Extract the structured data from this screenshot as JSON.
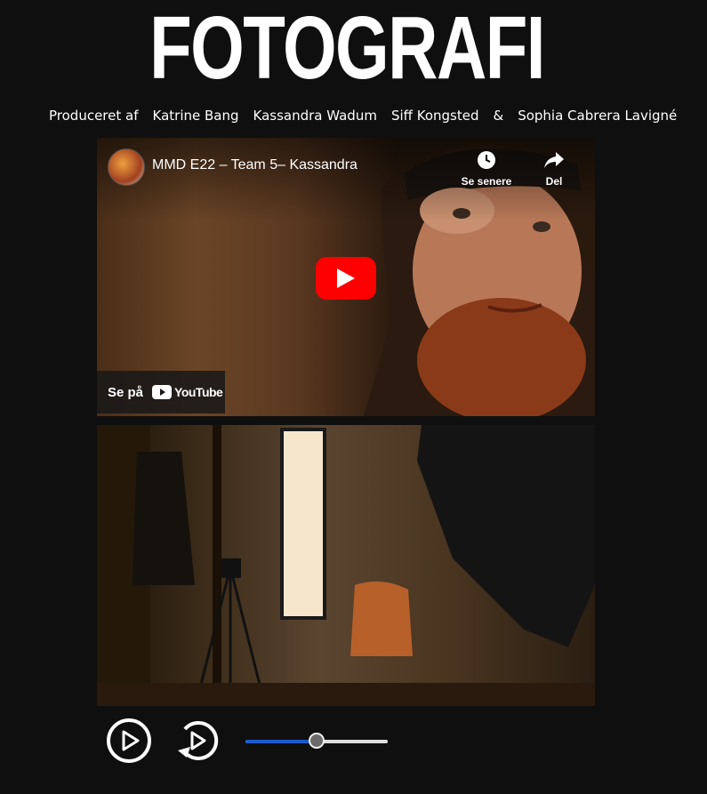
{
  "header": {
    "title": "FOTOGRAFI"
  },
  "credits": {
    "intro": "Produceret af",
    "names": [
      "Katrine Bang",
      "Kassandra Wadum",
      "Siff Kongsted"
    ],
    "ampersand": "&",
    "last": "Sophia Cabrera Lavigné"
  },
  "video": {
    "title": "MMD E22 – Team 5– Kassandra",
    "watch_later_label": "Se senere",
    "share_label": "Del",
    "watch_on_label": "Se på",
    "youtube_word": "YouTube",
    "play_color": "#ff0000"
  },
  "player_controls": {
    "play_icon": "play-icon",
    "replay_icon": "replay-icon",
    "volume_fraction": 0.5,
    "accent_color": "#1b5bd0"
  }
}
